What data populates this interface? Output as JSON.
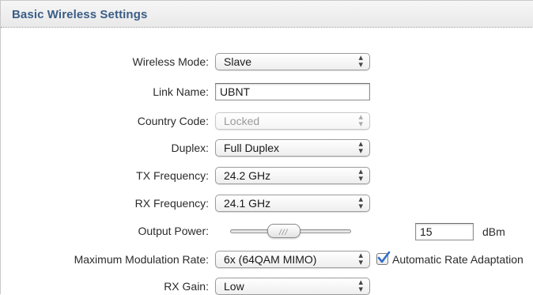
{
  "header": {
    "title": "Basic Wireless Settings"
  },
  "fields": {
    "wireless_mode": {
      "label": "Wireless Mode:",
      "value": "Slave"
    },
    "link_name": {
      "label": "Link Name:",
      "value": "UBNT"
    },
    "country_code": {
      "label": "Country Code:",
      "value": "Locked"
    },
    "duplex": {
      "label": "Duplex:",
      "value": "Full Duplex"
    },
    "tx_frequency": {
      "label": "TX Frequency:",
      "value": "24.2 GHz"
    },
    "rx_frequency": {
      "label": "RX Frequency:",
      "value": "24.1 GHz"
    },
    "output_power": {
      "label": "Output Power:",
      "value": "15",
      "unit": "dBm",
      "slider_fraction": 0.42
    },
    "max_modulation_rate": {
      "label": "Maximum Modulation Rate:",
      "value": "6x (64QAM MIMO)"
    },
    "automatic_rate_adaptation": {
      "label": "Automatic Rate Adaptation",
      "checked": true
    },
    "rx_gain": {
      "label": "RX Gain:",
      "value": "Low"
    }
  },
  "icons": {
    "select_chevron": "up-down-chevron-icon",
    "slider_grip": "grip-icon",
    "checkmark": "checkmark-icon"
  },
  "colors": {
    "header_title": "#3b5d86",
    "checkmark": "#2f6fc7"
  }
}
